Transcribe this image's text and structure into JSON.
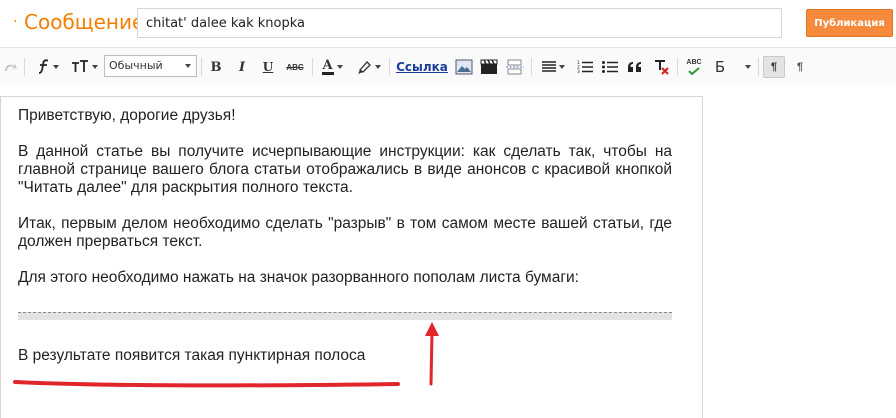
{
  "header": {
    "bullet": "·",
    "title": "Сообщение",
    "post_title_value": "chitat' dalee kak knopka",
    "publish_label": "Публикация"
  },
  "toolbar": {
    "format_value": "Обычный",
    "bold": "B",
    "italic": "I",
    "underline": "U",
    "strike": "ABC",
    "font_color": "A",
    "link_label": "Ссылка",
    "spellcheck": "ABC",
    "translit": "Б",
    "ltr": "¶",
    "rtl": "¶"
  },
  "editor": {
    "paragraphs": [
      "Приветствую, дорогие друзья!",
      "В данной статье вы получите исчерпывающие инструкции: как сделать так, чтобы на главной странице вашего блога статьи отображались в виде анонсов с красивой кнопкой \"Читать далее\" для раскрытия полного текста.",
      "Итак, первым делом необходимо сделать \"разрыв\" в том самом месте вашей статьи, где должен прерваться текст.",
      "Для этого необходимо нажать на значок разорванного пополам листа бумаги:"
    ],
    "result_text": "В результате появится такая пунктирная полоса"
  },
  "colors": {
    "accent": "#f57d00",
    "publish_bg": "#f68a3c",
    "annotation_red": "#e0252b",
    "link_blue": "#1a3d9b"
  }
}
